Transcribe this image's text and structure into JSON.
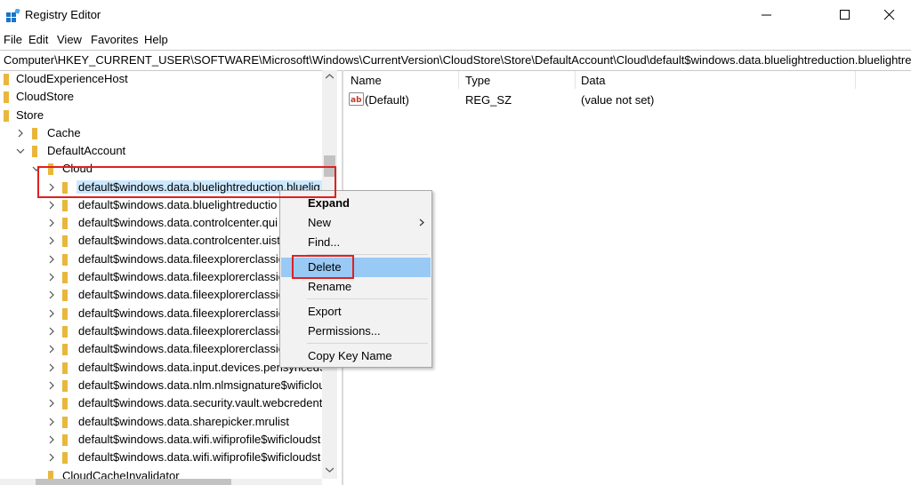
{
  "window": {
    "title": "Registry Editor",
    "accent_icon_color": "#1a73c8"
  },
  "menu": {
    "file": "File",
    "edit": "Edit",
    "view": "View",
    "favorites": "Favorites",
    "help": "Help"
  },
  "address": {
    "path": "Computer\\HKEY_CURRENT_USER\\SOFTWARE\\Microsoft\\Windows\\CurrentVersion\\CloudStore\\Store\\DefaultAccount\\Cloud\\default$windows.data.bluelightreduction.bluelightreduc"
  },
  "tree": {
    "items": [
      {
        "label": "CloudExperienceHost"
      },
      {
        "label": "CloudStore"
      },
      {
        "label": "Store"
      },
      {
        "label": "Cache"
      },
      {
        "label": "DefaultAccount"
      },
      {
        "label": "Cloud"
      },
      {
        "label": "default$windows.data.bluelightreduction.bluelig"
      },
      {
        "label": "default$windows.data.bluelightreductio"
      },
      {
        "label": "default$windows.data.controlcenter.qui"
      },
      {
        "label": "default$windows.data.controlcenter.uist"
      },
      {
        "label": "default$windows.data.fileexplorerclassic"
      },
      {
        "label": "default$windows.data.fileexplorerclassic"
      },
      {
        "label": "default$windows.data.fileexplorerclassic"
      },
      {
        "label": "default$windows.data.fileexplorerclassic"
      },
      {
        "label": "default$windows.data.fileexplorerclassic"
      },
      {
        "label": "default$windows.data.fileexplorerclassic"
      },
      {
        "label": "default$windows.data.input.devices.pensyncedS"
      },
      {
        "label": "default$windows.data.nlm.nlmsignature$wificlou"
      },
      {
        "label": "default$windows.data.security.vault.webcredenti"
      },
      {
        "label": "default$windows.data.sharepicker.mrulist"
      },
      {
        "label": "default$windows.data.wifi.wifiprofile$wificloudst"
      },
      {
        "label": "default$windows.data.wifi.wifiprofile$wificloudst"
      },
      {
        "label": "CloudCacheInvalidator"
      }
    ]
  },
  "list": {
    "headers": {
      "name": "Name",
      "type": "Type",
      "data": "Data"
    },
    "rows": [
      {
        "name": "(Default)",
        "type": "REG_SZ",
        "data": "(value not set)"
      }
    ]
  },
  "context_menu": {
    "expand": "Expand",
    "new": "New",
    "find": "Find...",
    "delete": "Delete",
    "rename": "Rename",
    "export": "Export",
    "permissions": "Permissions...",
    "copy_key_name": "Copy Key Name"
  },
  "colors": {
    "highlight": "#99c9f5",
    "selection": "#cce8ff",
    "annotation": "#e02020",
    "folder": "#e8b73c"
  }
}
